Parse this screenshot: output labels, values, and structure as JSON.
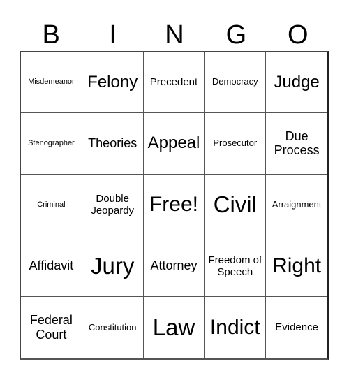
{
  "header": [
    "B",
    "I",
    "N",
    "G",
    "O"
  ],
  "cells": [
    {
      "text": "Misdemeanor",
      "size": "s-xs"
    },
    {
      "text": "Felony",
      "size": "s-xxl"
    },
    {
      "text": "Precedent",
      "size": "s-m"
    },
    {
      "text": "Democracy",
      "size": "s-s"
    },
    {
      "text": "Judge",
      "size": "s-xxl"
    },
    {
      "text": "Stenographer",
      "size": "s-xs"
    },
    {
      "text": "Theories",
      "size": "s-l"
    },
    {
      "text": "Appeal",
      "size": "s-xxl"
    },
    {
      "text": "Prosecutor",
      "size": "s-s"
    },
    {
      "text": "Due Process",
      "size": "s-l"
    },
    {
      "text": "Criminal",
      "size": "s-xs"
    },
    {
      "text": "Double Jeopardy",
      "size": "s-m"
    },
    {
      "text": "Free!",
      "size": "s-huge"
    },
    {
      "text": "Civil",
      "size": "s-giant"
    },
    {
      "text": "Arraignment",
      "size": "s-s"
    },
    {
      "text": "Affidavit",
      "size": "s-l"
    },
    {
      "text": "Jury",
      "size": "s-giant"
    },
    {
      "text": "Attorney",
      "size": "s-l"
    },
    {
      "text": "Freedom of Speech",
      "size": "s-m"
    },
    {
      "text": "Right",
      "size": "s-huge"
    },
    {
      "text": "Federal Court",
      "size": "s-l"
    },
    {
      "text": "Constitution",
      "size": "s-s"
    },
    {
      "text": "Law",
      "size": "s-giant"
    },
    {
      "text": "Indict",
      "size": "s-huge"
    },
    {
      "text": "Evidence",
      "size": "s-m"
    }
  ]
}
